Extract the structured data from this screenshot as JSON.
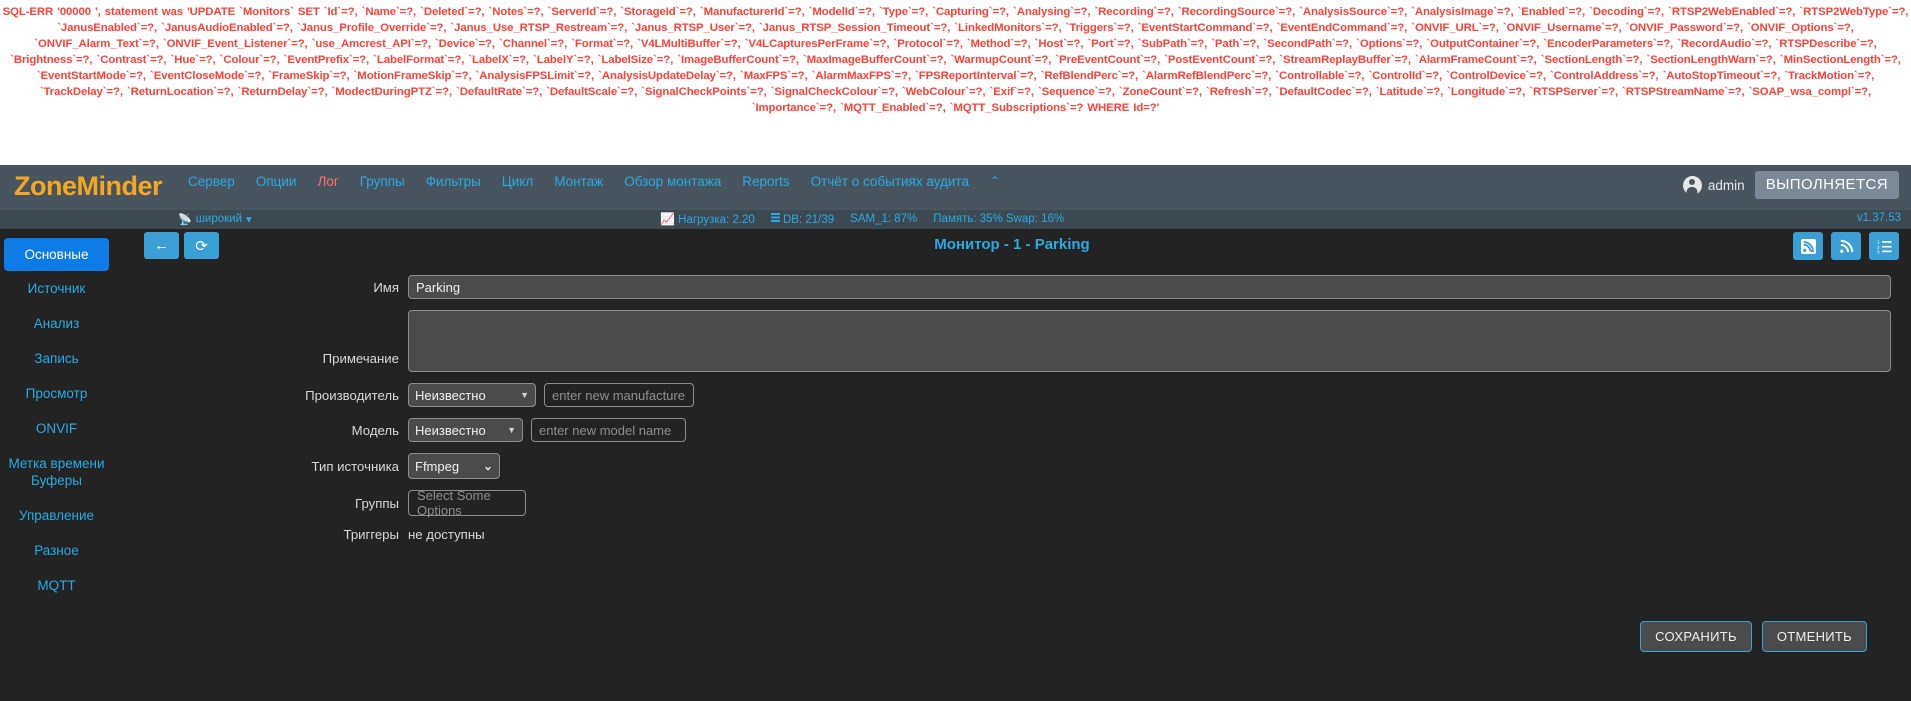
{
  "sql_error": "SQL-ERR '00000 ', statement was 'UPDATE `Monitors` SET `Id`=?, `Name`=?, `Deleted`=?, `Notes`=?, `ServerId`=?, `StorageId`=?, `ManufacturerId`=?, `ModelId`=?, `Type`=?, `Capturing`=?, `Analysing`=?, `Recording`=?, `RecordingSource`=?, `AnalysisSource`=?, `AnalysisImage`=?, `Enabled`=?, `Decoding`=?, `RTSP2WebEnabled`=?, `RTSP2WebType`=?, `JanusEnabled`=?, `JanusAudioEnabled`=?, `Janus_Profile_Override`=?, `Janus_Use_RTSP_Restream`=?, `Janus_RTSP_User`=?, `Janus_RTSP_Session_Timeout`=?, `LinkedMonitors`=?, `Triggers`=?, `EventStartCommand`=?, `EventEndCommand`=?, `ONVIF_URL`=?, `ONVIF_Username`=?, `ONVIF_Password`=?, `ONVIF_Options`=?, `ONVIF_Alarm_Text`=?, `ONVIF_Event_Listener`=?, `use_Amcrest_API`=?, `Device`=?, `Channel`=?, `Format`=?, `V4LMultiBuffer`=?, `V4LCapturesPerFrame`=?, `Protocol`=?, `Method`=?, `Host`=?, `Port`=?, `SubPath`=?, `Path`=?, `SecondPath`=?, `Options`=?, `OutputContainer`=?, `EncoderParameters`=?, `RecordAudio`=?, `RTSPDescribe`=?, `Brightness`=?, `Contrast`=?, `Hue`=?, `Colour`=?, `EventPrefix`=?, `LabelFormat`=?, `LabelX`=?, `LabelY`=?, `LabelSize`=?, `ImageBufferCount`=?, `MaxImageBufferCount`=?, `WarmupCount`=?, `PreEventCount`=?, `PostEventCount`=?, `StreamReplayBuffer`=?, `AlarmFrameCount`=?, `SectionLength`=?, `SectionLengthWarn`=?, `MinSectionLength`=?, `EventStartMode`=?, `EventCloseMode`=?, `FrameSkip`=?, `MotionFrameSkip`=?, `AnalysisFPSLimit`=?, `AnalysisUpdateDelay`=?, `MaxFPS`=?, `AlarmMaxFPS`=?, `FPSReportInterval`=?, `RefBlendPerc`=?, `AlarmRefBlendPerc`=?, `Controllable`=?, `ControlId`=?, `ControlDevice`=?, `ControlAddress`=?, `AutoStopTimeout`=?, `TrackMotion`=?, `TrackDelay`=?, `ReturnLocation`=?, `ReturnDelay`=?, `ModectDuringPTZ`=?, `DefaultRate`=?, `DefaultScale`=?, `SignalCheckPoints`=?, `SignalCheckColour`=?, `WebColour`=?, `Exif`=?, `Sequence`=?, `ZoneCount`=?, `Refresh`=?, `DefaultCodec`=?, `Latitude`=?, `Longitude`=?, `RTSPServer`=?, `RTSPStreamName`=?, `SOAP_wsa_compl`=?, `Importance`=?, `MQTT_Enabled`=?, `MQTT_Subscriptions`=? WHERE Id=?'",
  "navbar": {
    "brand": "ZoneMinder",
    "menu": [
      {
        "label": "Сервер",
        "active": false
      },
      {
        "label": "Опции",
        "active": false
      },
      {
        "label": "Лог",
        "active": true
      },
      {
        "label": "Группы",
        "active": false
      },
      {
        "label": "Фильтры",
        "active": false
      },
      {
        "label": "Цикл",
        "active": false
      },
      {
        "label": "Монтаж",
        "active": false
      },
      {
        "label": "Обзор монтажа",
        "active": false
      },
      {
        "label": "Reports",
        "active": false
      },
      {
        "label": "Отчёт о событиях аудита",
        "active": false
      }
    ],
    "collapse_caret": "⌃",
    "user": "admin",
    "run_state": "ВЫПОЛНЯЕТСЯ"
  },
  "status": {
    "bandwidth": "широкий",
    "bandwidth_caret": "▾",
    "load": "Нагрузка: 2.20",
    "db": "DB: 21/39",
    "storage": "SAM_1: 87%",
    "memory": "Память: 35% Swap: 16%",
    "version": "v1.37.53"
  },
  "sidebar": {
    "items": [
      {
        "label": "Основные",
        "active": true
      },
      {
        "label": "Источник",
        "active": false
      },
      {
        "label": "Анализ",
        "active": false
      },
      {
        "label": "Запись",
        "active": false
      },
      {
        "label": "Просмотр",
        "active": false
      },
      {
        "label": "ONVIF",
        "active": false
      },
      {
        "label": "Метка времени Буферы",
        "active": false
      },
      {
        "label": "Управление",
        "active": false
      },
      {
        "label": "Разное",
        "active": false
      },
      {
        "label": "MQTT",
        "active": false
      }
    ]
  },
  "toolbar": {
    "back_icon": "←",
    "refresh_icon": "⟳",
    "title": "Монитор - 1 - Parking",
    "right_icons": [
      "rss-square-icon",
      "rss-icon",
      "list-ol-icon"
    ]
  },
  "form": {
    "name_label": "Имя",
    "name_value": "Parking",
    "notes_label": "Примечание",
    "notes_value": "",
    "manufacturer_label": "Производитель",
    "manufacturer_value": "Неизвестно",
    "manufacturer_placeholder": "enter new manufacturer name",
    "model_label": "Модель",
    "model_value": "Неизвестно",
    "model_placeholder": "enter new model name",
    "source_type_label": "Тип источника",
    "source_type_value": "Ffmpeg",
    "groups_label": "Группы",
    "groups_placeholder": "Select Some Options",
    "triggers_label": "Триггеры",
    "triggers_value": "не доступны"
  },
  "actions": {
    "save": "СОХРАНИТЬ",
    "cancel": "ОТМЕНИТЬ"
  },
  "colors": {
    "brand": "#f5a623",
    "accent": "#29abe2",
    "active": "#0d7ce6",
    "error": "#ff4136",
    "navbar_bg": "#48555f",
    "page_bg": "#232323"
  }
}
